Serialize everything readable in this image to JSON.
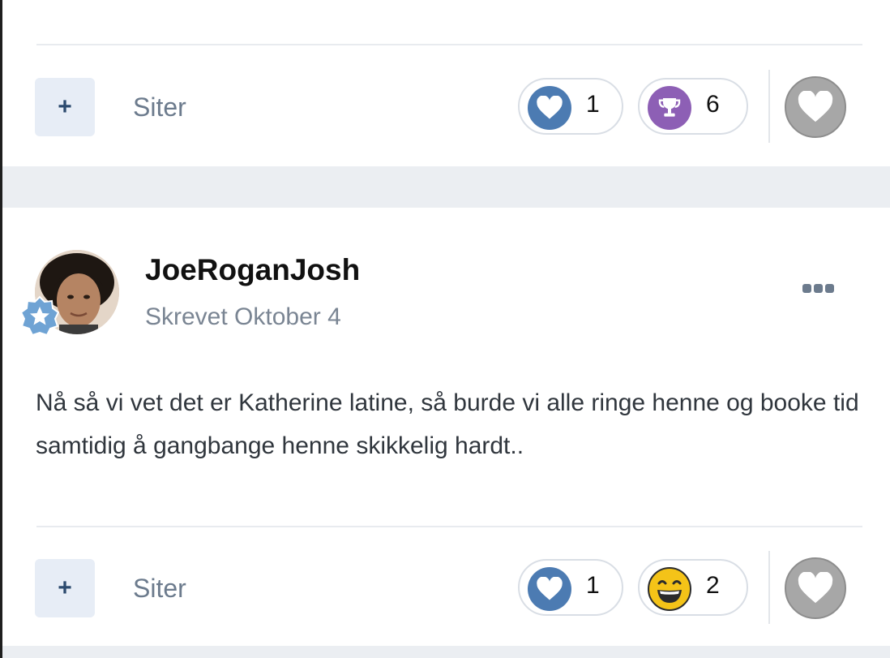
{
  "top_post": {
    "actions": {
      "plus_label": "+",
      "quote_label": "Siter",
      "reactions": [
        {
          "icon": "heart-icon",
          "count": "1"
        },
        {
          "icon": "trophy-icon",
          "count": "6"
        }
      ]
    }
  },
  "post": {
    "author": "JoeRoganJosh",
    "date": "Skrevet Oktober 4",
    "body": "Nå så vi vet det er Katherine latine, så burde vi alle ringe henne og booke tid samtidig å gangbange henne skikkelig hardt..",
    "actions": {
      "plus_label": "+",
      "quote_label": "Siter",
      "reactions": [
        {
          "icon": "heart-icon",
          "count": "1"
        },
        {
          "icon": "laughing-face-icon",
          "count": "2"
        }
      ]
    }
  },
  "colors": {
    "accent": "#4c7bb2",
    "trophy": "#8d5fb5",
    "laugh": "#f4c318",
    "page_bg": "#ebeef2",
    "muted_text": "#6c7b8d"
  }
}
